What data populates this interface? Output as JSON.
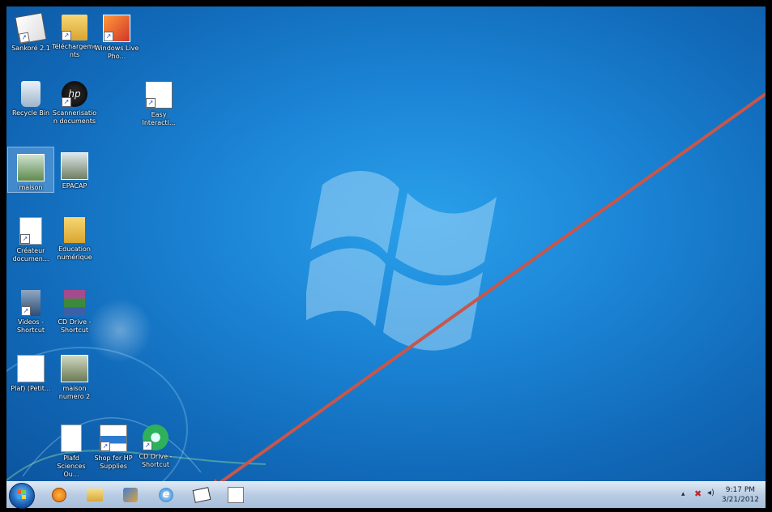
{
  "desktop": {
    "icons": [
      {
        "label": "Sankoré 2.1"
      },
      {
        "label": "Téléchargements"
      },
      {
        "label": "Windows Live Pho..."
      },
      {
        "label": "Recycle Bin"
      },
      {
        "label": "Scannerisation documents"
      },
      {
        "label": "Easy Interacti..."
      },
      {
        "label": "maison"
      },
      {
        "label": "EPACAP"
      },
      {
        "label": "Créateur documen..."
      },
      {
        "label": "Education numérique"
      },
      {
        "label": "Videos - Shortcut"
      },
      {
        "label": "CD Drive - Shortcut"
      },
      {
        "label": "Plaf) (Petit..."
      },
      {
        "label": "maison numero 2"
      },
      {
        "label": "Plafd Sciences Ou..."
      },
      {
        "label": "Shop for HP Supplies"
      },
      {
        "label": "CD Drive - Shortcut"
      }
    ]
  },
  "taskbar": {
    "items": [
      "start-orb",
      "media-player-icon",
      "file-explorer-icon",
      "people-icon",
      "internet-explorer-icon",
      "sankore-icon",
      "easy-interactive-icon"
    ],
    "clock_time": "9:17 PM",
    "clock_date": "3/21/2012"
  },
  "annotation": {
    "color": "#c8564a"
  }
}
